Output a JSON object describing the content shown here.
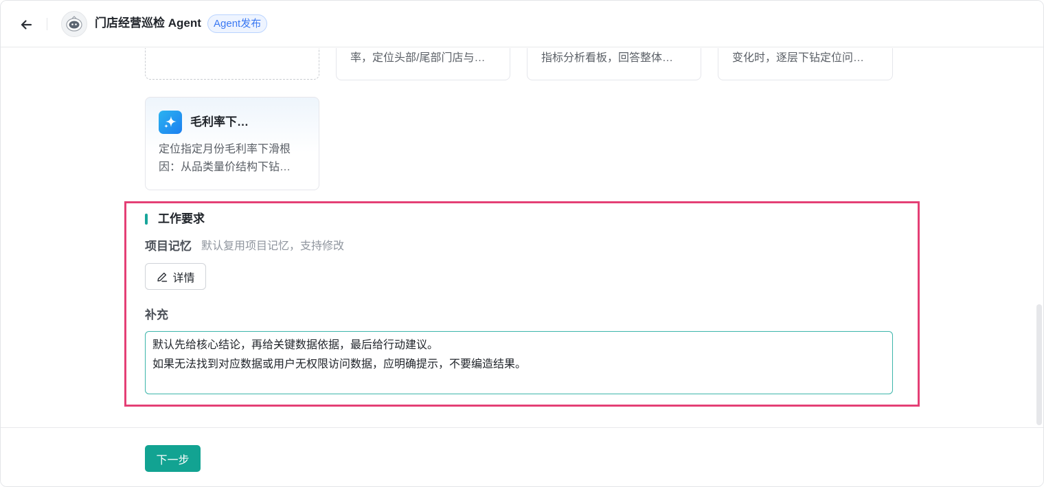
{
  "header": {
    "title": "门店经营巡检 Agent",
    "badge": "Agent发布"
  },
  "top_cards": [
    {
      "desc": ""
    },
    {
      "desc": "率，定位头部/尾部门店与…"
    },
    {
      "desc": "指标分析看板，回答整体…"
    },
    {
      "desc": "变化时，逐层下钻定位问…"
    }
  ],
  "skill_card": {
    "title": "毛利率下…",
    "desc_lines": [
      "定位指定月份毛利率下滑根",
      "因：从品类量价结构下钻…"
    ],
    "icon": "sparkle-icon"
  },
  "work_requirements": {
    "title": "工作要求",
    "memory_label": "项目记忆",
    "memory_hint": "默认复用项目记忆，支持修改",
    "detail_button": "详情",
    "supplement_label": "补充",
    "supplement_lines": [
      "默认先给核心结论，再给关键数据依据，最后给行动建议。",
      "如果无法找到对应数据或用户无权限访问数据，应明确提示，不要编造结果。"
    ]
  },
  "footer": {
    "next_button": "下一步"
  },
  "colors": {
    "accent": "#12a392",
    "highlight": "#e43f75",
    "badge": "#3a78f2"
  }
}
